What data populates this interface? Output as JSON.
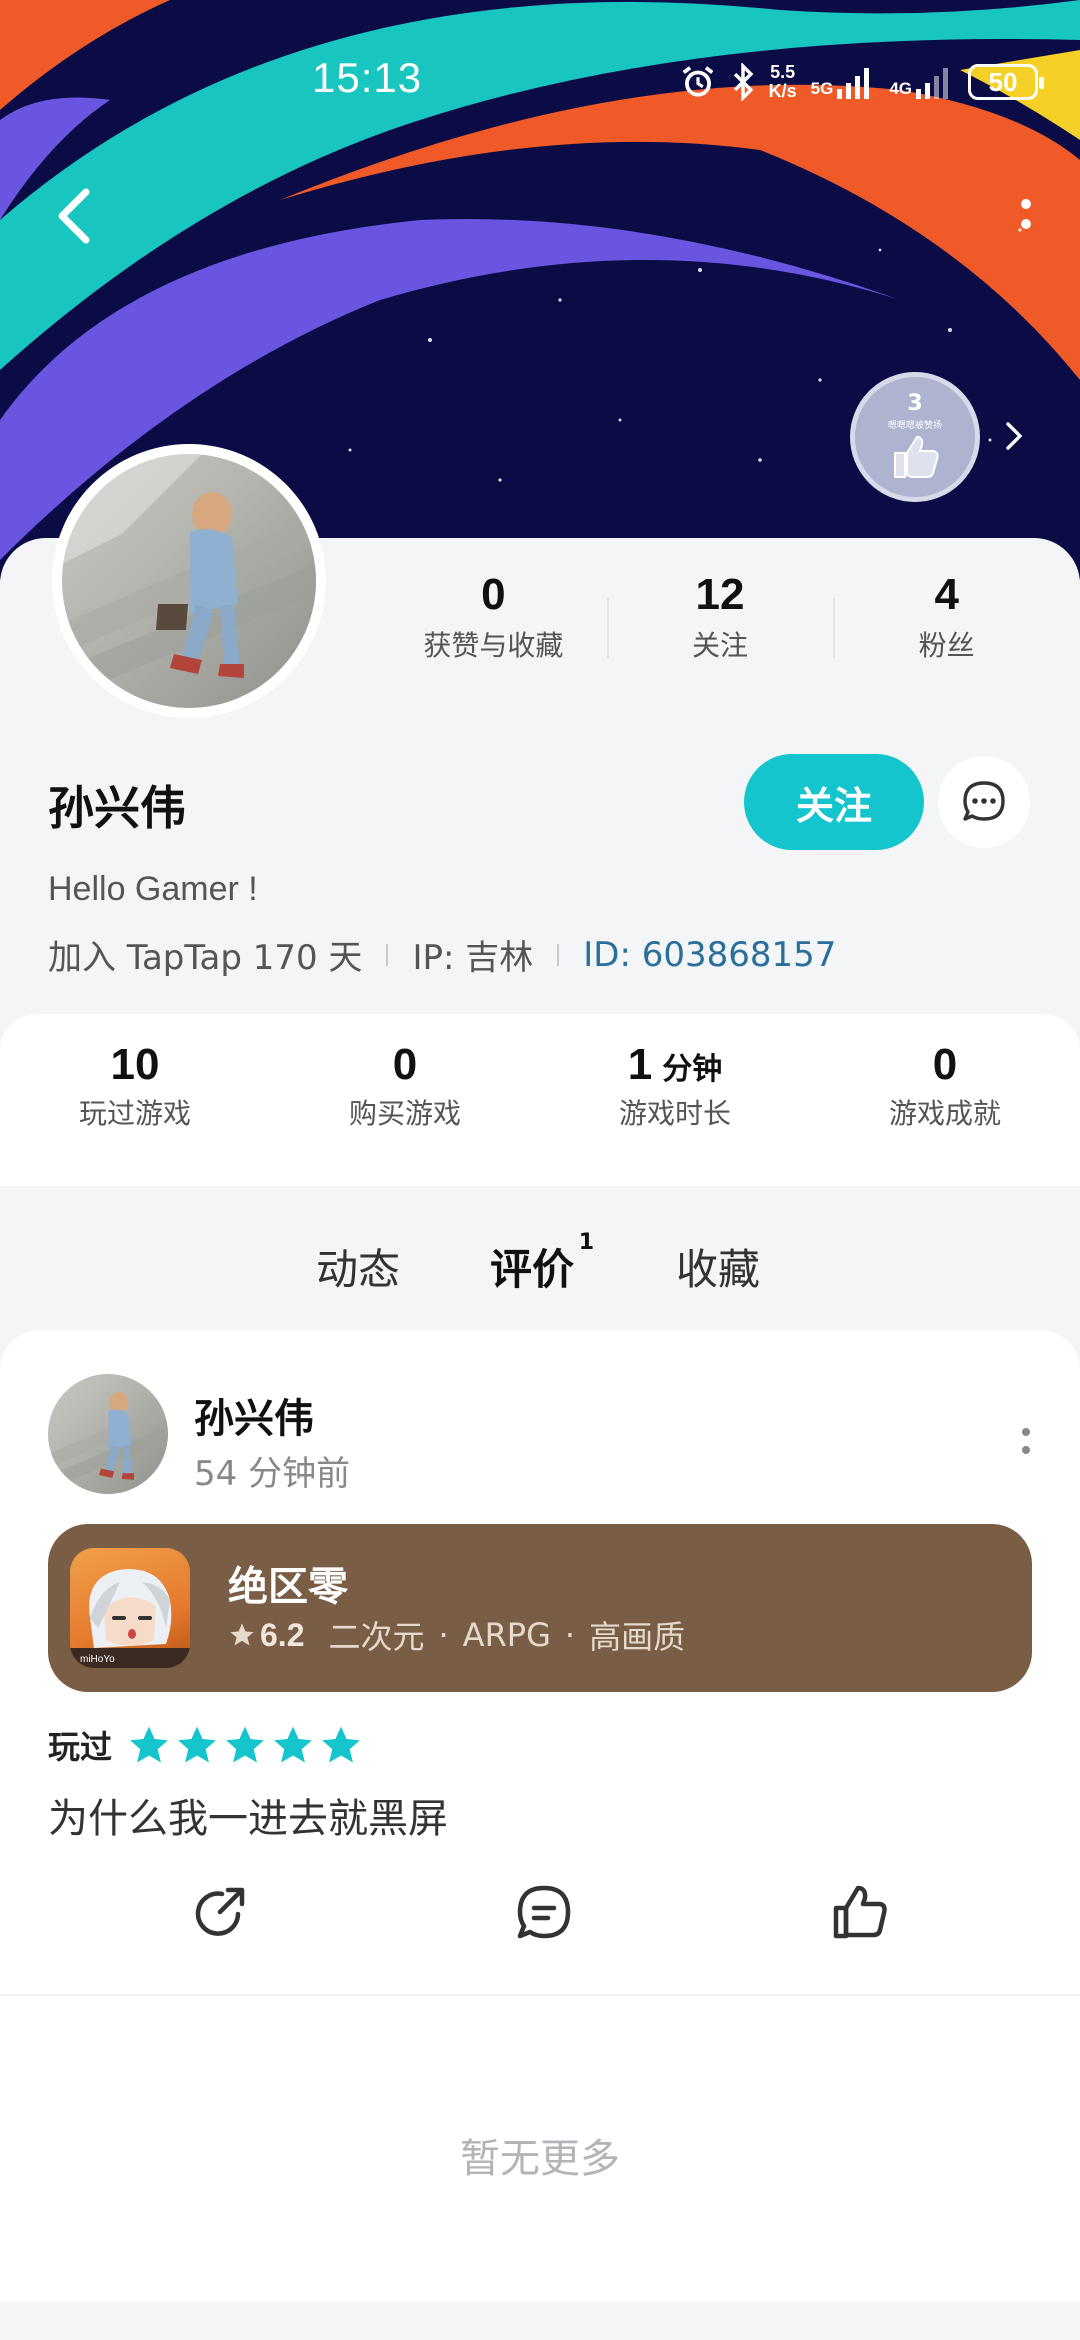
{
  "status_bar": {
    "time": "15:13",
    "speed_value": "5.5",
    "speed_unit": "K/s",
    "net_1": "5G",
    "net_2": "4G",
    "battery": "50"
  },
  "badge": {
    "level": "3",
    "name": "嗯嗯嗯被赞扬"
  },
  "profile": {
    "stats": [
      {
        "value": "0",
        "label": "获赞与收藏"
      },
      {
        "value": "12",
        "label": "关注"
      },
      {
        "value": "4",
        "label": "粉丝"
      }
    ],
    "name": "孙兴伟",
    "follow_label": "关注",
    "bio": "Hello Gamer !",
    "join_text": "加入 TapTap 170 天",
    "ip_text": "IP:  吉林",
    "id_text": "ID:  603868157"
  },
  "game_stats": [
    {
      "value": "10",
      "unit": "",
      "label": "玩过游戏"
    },
    {
      "value": "0",
      "unit": "",
      "label": "购买游戏"
    },
    {
      "value": "1",
      "unit": "分钟",
      "label": "游戏时长"
    },
    {
      "value": "0",
      "unit": "",
      "label": "游戏成就"
    }
  ],
  "tabs": [
    {
      "label": "动态"
    },
    {
      "label": "评价",
      "count": "1"
    },
    {
      "label": "收藏"
    }
  ],
  "review": {
    "author": "孙兴伟",
    "time_ago": "54 分钟前",
    "game_name": "绝区零",
    "game_score": "6.2",
    "game_tags": [
      "二次元",
      "ARPG",
      "高画质"
    ],
    "game_icon_brand": "miHoYo",
    "played_label": "玩过",
    "stars": 5,
    "text": "为什么我一进去就黑屏"
  },
  "footer": {
    "no_more": "暂无更多"
  },
  "colors": {
    "accent": "#15c5ce",
    "hero_bg": "#0b0c46",
    "game_card": "#7a5d45",
    "id_link": "#2a6f9a"
  }
}
